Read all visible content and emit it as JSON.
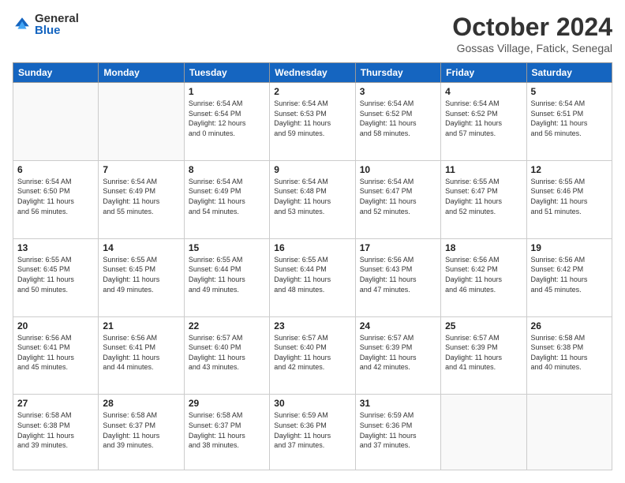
{
  "logo": {
    "general": "General",
    "blue": "Blue"
  },
  "title": "October 2024",
  "location": "Gossas Village, Fatick, Senegal",
  "headers": [
    "Sunday",
    "Monday",
    "Tuesday",
    "Wednesday",
    "Thursday",
    "Friday",
    "Saturday"
  ],
  "weeks": [
    [
      {
        "day": "",
        "info": ""
      },
      {
        "day": "",
        "info": ""
      },
      {
        "day": "1",
        "info": "Sunrise: 6:54 AM\nSunset: 6:54 PM\nDaylight: 12 hours\nand 0 minutes."
      },
      {
        "day": "2",
        "info": "Sunrise: 6:54 AM\nSunset: 6:53 PM\nDaylight: 11 hours\nand 59 minutes."
      },
      {
        "day": "3",
        "info": "Sunrise: 6:54 AM\nSunset: 6:52 PM\nDaylight: 11 hours\nand 58 minutes."
      },
      {
        "day": "4",
        "info": "Sunrise: 6:54 AM\nSunset: 6:52 PM\nDaylight: 11 hours\nand 57 minutes."
      },
      {
        "day": "5",
        "info": "Sunrise: 6:54 AM\nSunset: 6:51 PM\nDaylight: 11 hours\nand 56 minutes."
      }
    ],
    [
      {
        "day": "6",
        "info": "Sunrise: 6:54 AM\nSunset: 6:50 PM\nDaylight: 11 hours\nand 56 minutes."
      },
      {
        "day": "7",
        "info": "Sunrise: 6:54 AM\nSunset: 6:49 PM\nDaylight: 11 hours\nand 55 minutes."
      },
      {
        "day": "8",
        "info": "Sunrise: 6:54 AM\nSunset: 6:49 PM\nDaylight: 11 hours\nand 54 minutes."
      },
      {
        "day": "9",
        "info": "Sunrise: 6:54 AM\nSunset: 6:48 PM\nDaylight: 11 hours\nand 53 minutes."
      },
      {
        "day": "10",
        "info": "Sunrise: 6:54 AM\nSunset: 6:47 PM\nDaylight: 11 hours\nand 52 minutes."
      },
      {
        "day": "11",
        "info": "Sunrise: 6:55 AM\nSunset: 6:47 PM\nDaylight: 11 hours\nand 52 minutes."
      },
      {
        "day": "12",
        "info": "Sunrise: 6:55 AM\nSunset: 6:46 PM\nDaylight: 11 hours\nand 51 minutes."
      }
    ],
    [
      {
        "day": "13",
        "info": "Sunrise: 6:55 AM\nSunset: 6:45 PM\nDaylight: 11 hours\nand 50 minutes."
      },
      {
        "day": "14",
        "info": "Sunrise: 6:55 AM\nSunset: 6:45 PM\nDaylight: 11 hours\nand 49 minutes."
      },
      {
        "day": "15",
        "info": "Sunrise: 6:55 AM\nSunset: 6:44 PM\nDaylight: 11 hours\nand 49 minutes."
      },
      {
        "day": "16",
        "info": "Sunrise: 6:55 AM\nSunset: 6:44 PM\nDaylight: 11 hours\nand 48 minutes."
      },
      {
        "day": "17",
        "info": "Sunrise: 6:56 AM\nSunset: 6:43 PM\nDaylight: 11 hours\nand 47 minutes."
      },
      {
        "day": "18",
        "info": "Sunrise: 6:56 AM\nSunset: 6:42 PM\nDaylight: 11 hours\nand 46 minutes."
      },
      {
        "day": "19",
        "info": "Sunrise: 6:56 AM\nSunset: 6:42 PM\nDaylight: 11 hours\nand 45 minutes."
      }
    ],
    [
      {
        "day": "20",
        "info": "Sunrise: 6:56 AM\nSunset: 6:41 PM\nDaylight: 11 hours\nand 45 minutes."
      },
      {
        "day": "21",
        "info": "Sunrise: 6:56 AM\nSunset: 6:41 PM\nDaylight: 11 hours\nand 44 minutes."
      },
      {
        "day": "22",
        "info": "Sunrise: 6:57 AM\nSunset: 6:40 PM\nDaylight: 11 hours\nand 43 minutes."
      },
      {
        "day": "23",
        "info": "Sunrise: 6:57 AM\nSunset: 6:40 PM\nDaylight: 11 hours\nand 42 minutes."
      },
      {
        "day": "24",
        "info": "Sunrise: 6:57 AM\nSunset: 6:39 PM\nDaylight: 11 hours\nand 42 minutes."
      },
      {
        "day": "25",
        "info": "Sunrise: 6:57 AM\nSunset: 6:39 PM\nDaylight: 11 hours\nand 41 minutes."
      },
      {
        "day": "26",
        "info": "Sunrise: 6:58 AM\nSunset: 6:38 PM\nDaylight: 11 hours\nand 40 minutes."
      }
    ],
    [
      {
        "day": "27",
        "info": "Sunrise: 6:58 AM\nSunset: 6:38 PM\nDaylight: 11 hours\nand 39 minutes."
      },
      {
        "day": "28",
        "info": "Sunrise: 6:58 AM\nSunset: 6:37 PM\nDaylight: 11 hours\nand 39 minutes."
      },
      {
        "day": "29",
        "info": "Sunrise: 6:58 AM\nSunset: 6:37 PM\nDaylight: 11 hours\nand 38 minutes."
      },
      {
        "day": "30",
        "info": "Sunrise: 6:59 AM\nSunset: 6:36 PM\nDaylight: 11 hours\nand 37 minutes."
      },
      {
        "day": "31",
        "info": "Sunrise: 6:59 AM\nSunset: 6:36 PM\nDaylight: 11 hours\nand 37 minutes."
      },
      {
        "day": "",
        "info": ""
      },
      {
        "day": "",
        "info": ""
      }
    ]
  ]
}
